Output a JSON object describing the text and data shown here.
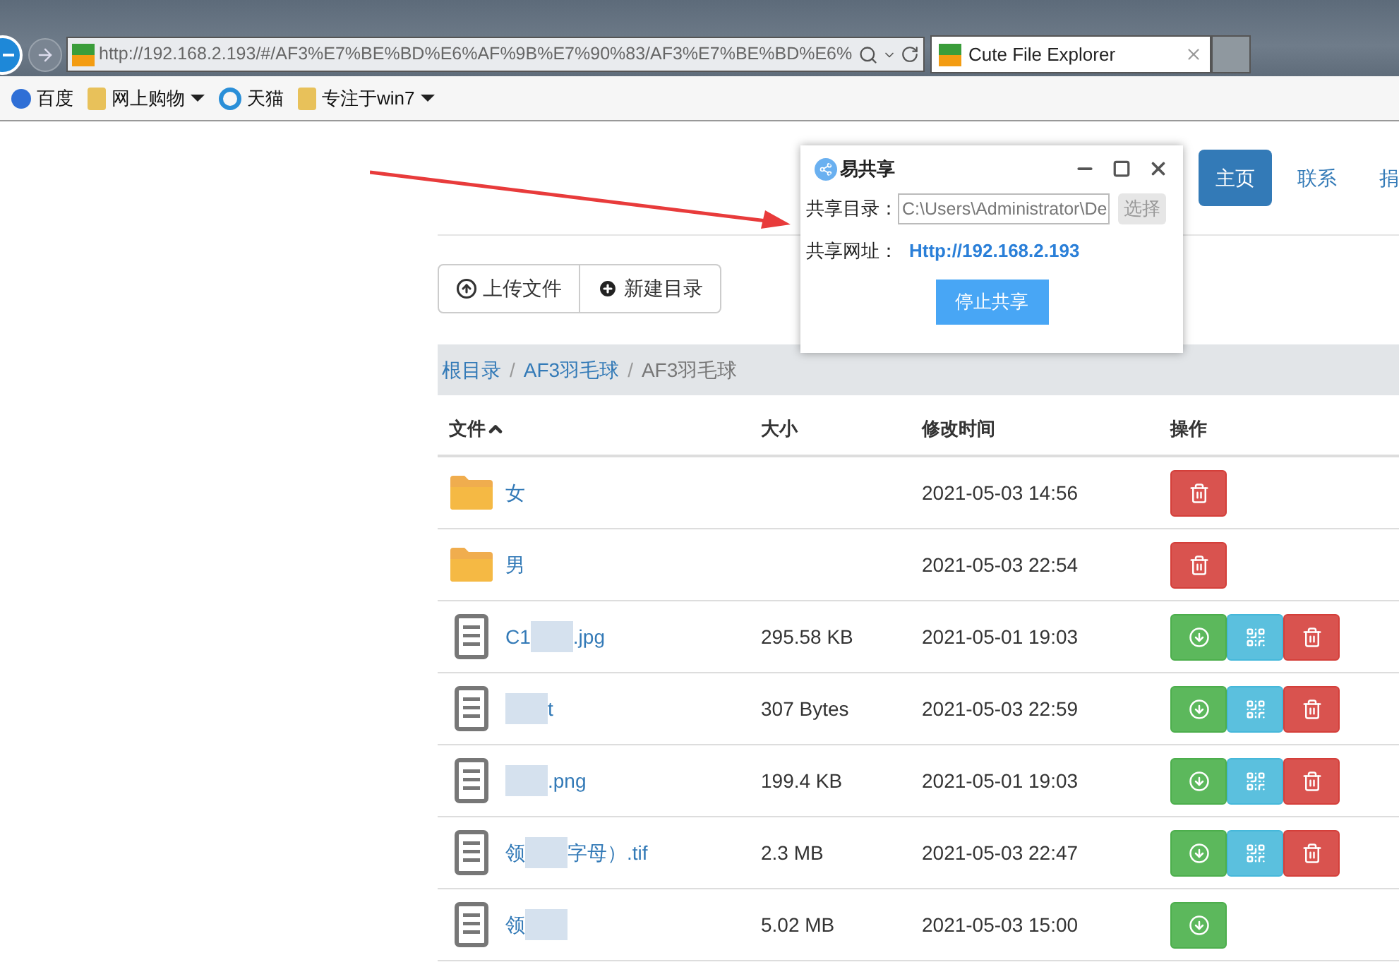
{
  "browser": {
    "address": "http://192.168.2.193/#/AF3%E7%BE%BD%E6%AF%9B%E7%90%83/AF3%E7%BE%BD%E6%",
    "tabs": [
      {
        "title": "Cute File Explorer",
        "selected": true
      }
    ],
    "favorites": [
      {
        "label": "百度",
        "kind": "site",
        "menu": false
      },
      {
        "label": "网上购物",
        "kind": "folder",
        "menu": true
      },
      {
        "label": "天猫",
        "kind": "ie",
        "menu": false
      },
      {
        "label": "专注于win7",
        "kind": "folder",
        "menu": true
      }
    ]
  },
  "nav": [
    {
      "label": "主页",
      "selected": true
    },
    {
      "label": "联系",
      "selected": false
    },
    {
      "label": "捐",
      "selected": false
    }
  ],
  "toolbar": [
    {
      "label": "上传文件",
      "kind": "upload"
    },
    {
      "label": "新建目录",
      "kind": "new"
    }
  ],
  "breadcrumb": [
    {
      "label": "根目录",
      "link": true
    },
    {
      "sep": "/",
      "label": "AF3羽毛球",
      "link": true
    },
    {
      "sep": "/",
      "label": "AF3羽毛球",
      "link": false
    }
  ],
  "table": {
    "columns": [
      "文件",
      "大小",
      "修改时间",
      "操作"
    ],
    "rows": [
      {
        "kind": "folder",
        "name_before": "女",
        "modified": "2021-05-03 14:56",
        "actions": [
          {
            "kind": "delete"
          }
        ]
      },
      {
        "kind": "folder",
        "name_before": "男",
        "modified": "2021-05-03 22:54",
        "actions": [
          {
            "kind": "delete"
          }
        ]
      },
      {
        "kind": "file",
        "name_before": "C1",
        "name_after": ".jpg",
        "size": "295.58 KB",
        "modified": "2021-05-01 19:03",
        "actions": [
          {
            "kind": "download"
          },
          {
            "kind": "qr"
          },
          {
            "kind": "delete"
          }
        ]
      },
      {
        "kind": "file",
        "name_after": "t",
        "size": "307 Bytes",
        "modified": "2021-05-03 22:59",
        "actions": [
          {
            "kind": "download"
          },
          {
            "kind": "qr"
          },
          {
            "kind": "delete"
          }
        ]
      },
      {
        "kind": "file",
        "name_after": ".png",
        "size": "199.4 KB",
        "modified": "2021-05-01 19:03",
        "actions": [
          {
            "kind": "download"
          },
          {
            "kind": "qr"
          },
          {
            "kind": "delete"
          }
        ]
      },
      {
        "kind": "file",
        "name_before": "领",
        "name_after": "字母）.tif",
        "size": "2.3 MB",
        "modified": "2021-05-03 22:47",
        "actions": [
          {
            "kind": "download"
          },
          {
            "kind": "qr"
          },
          {
            "kind": "delete"
          }
        ]
      },
      {
        "kind": "file",
        "name_before": "领",
        "size": "5.02 MB",
        "modified": "2021-05-03 15:00",
        "actions": [
          {
            "kind": "download"
          }
        ]
      }
    ]
  },
  "dialog": {
    "title": "易共享",
    "dir_label": "共享目录：",
    "dir_value": "C:\\Users\\Administrator\\De",
    "choose": "选择",
    "url_label": "共享网址：",
    "url": "Http://192.168.2.193",
    "stop": "停止共享"
  }
}
